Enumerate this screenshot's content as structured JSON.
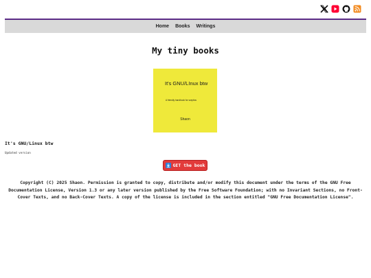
{
  "social": {
    "icons": [
      "x-twitter-icon",
      "youtube-icon",
      "github-icon",
      "rss-icon"
    ],
    "colors": {
      "youtube": "#ff0033",
      "rss": "#f28a1f"
    }
  },
  "nav": {
    "items": [
      "Home",
      "Books",
      "Writings"
    ]
  },
  "page": {
    "title": "My tiny books"
  },
  "book": {
    "cover_title": "It's GNU/LInux btw",
    "cover_subtitle": "A friendly handbook for sceptics",
    "cover_author": "Shaon",
    "name": "It's GNU/Linux btw",
    "description": "Updated version",
    "button_label": "GET the book",
    "button_icon": "download-icon"
  },
  "footer": {
    "license": "Copyright (C) 2025 Shaon. Permission is granted to copy, distribute and/or modify this document under the terms of the GNU Free Documentation License, Version 1.3 or any later version published by the Free Software Foundation; with no Invariant Sections, no Front-Cover Texts, and no Back-Cover Texts. A copy of the license is included in the section entitled \"GNU Free Documentation License\"."
  },
  "theme": {
    "accent": "#5b2a86",
    "nav_bg": "#d9d9d9",
    "cover_bg": "#efe93a",
    "button_bg": "#e23b3b"
  }
}
